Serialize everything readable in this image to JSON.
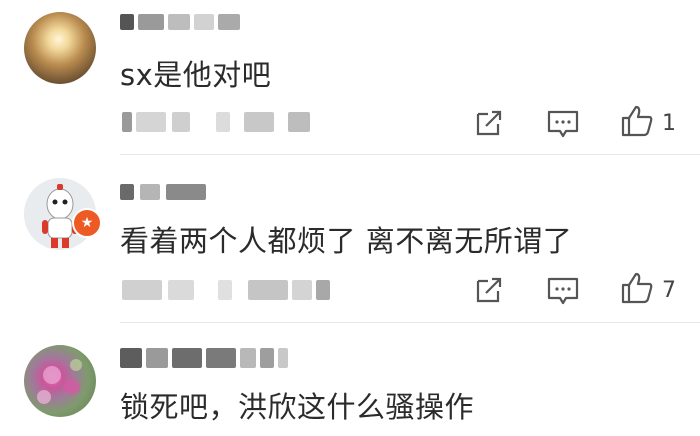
{
  "comments": [
    {
      "text": "sx是他对吧",
      "like_count": "1",
      "avatar_icon": "sunset-photo-avatar"
    },
    {
      "text": "看着两个人都烦了  离不离无所谓了",
      "like_count": "7",
      "avatar_icon": "mascot-avatar",
      "badge_icon": "verified-star-badge"
    },
    {
      "text": "锁死吧，洪欣这什么骚操作",
      "like_count": "",
      "avatar_icon": "flower-photo-avatar"
    }
  ],
  "icons": {
    "share": "share-icon",
    "reply": "reply-icon",
    "like": "thumbs-up-icon"
  },
  "colors": {
    "text": "#2b2b2b",
    "icon": "#555555",
    "divider": "#e8e8e8",
    "badge": "#ee5a24"
  }
}
